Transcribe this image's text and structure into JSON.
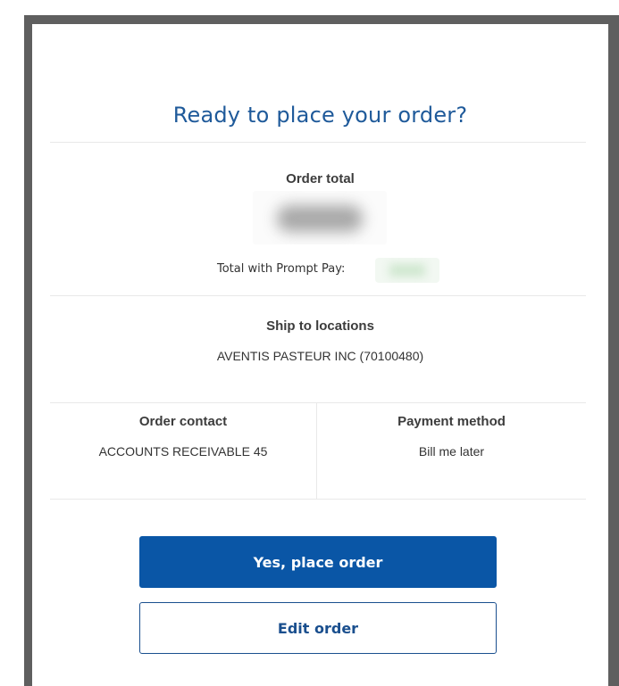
{
  "modal": {
    "title": "Ready to place your order?",
    "order_total": {
      "label": "Order total",
      "prompt_pay_label": "Total with Prompt Pay:"
    },
    "ship_to": {
      "label": "Ship to locations",
      "value": "AVENTIS PASTEUR INC (70100480)"
    },
    "order_contact": {
      "label": "Order contact",
      "value": "ACCOUNTS RECEIVABLE 45"
    },
    "payment_method": {
      "label": "Payment method",
      "value": "Bill me later"
    },
    "buttons": {
      "confirm_label": "Yes, place order",
      "edit_label": "Edit order"
    }
  },
  "colors": {
    "title": "#1f5a9a",
    "primary_button": "#0a56a6",
    "secondary_border": "#1a4f8e",
    "overlay_frame": "#5f5f5f"
  }
}
